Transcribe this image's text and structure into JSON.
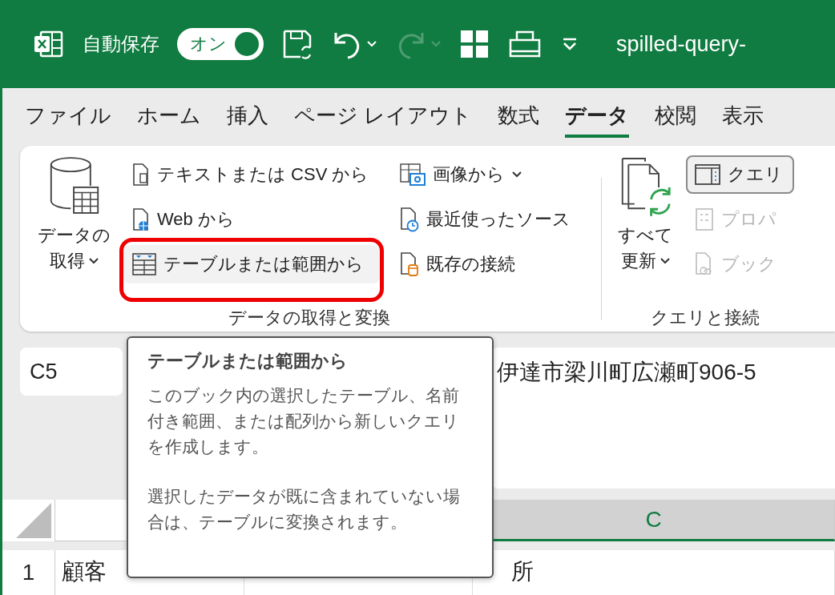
{
  "title_bar": {
    "autosave_label": "自動保存",
    "autosave": {
      "label": "オン",
      "on": true
    },
    "undo_disabled": false,
    "redo_disabled": true,
    "file_name": "spilled-query-"
  },
  "tabs": [
    {
      "label": "ファイル",
      "selected": false
    },
    {
      "label": "ホーム",
      "selected": false
    },
    {
      "label": "挿入",
      "selected": false
    },
    {
      "label": "ページ レイアウト",
      "selected": false
    },
    {
      "label": "数式",
      "selected": false
    },
    {
      "label": "データ",
      "selected": true
    },
    {
      "label": "校閲",
      "selected": false
    },
    {
      "label": "表示",
      "selected": false
    }
  ],
  "ribbon": {
    "groups": [
      {
        "label": "データの取得と変換",
        "large_button": {
          "kind": "database",
          "lines": [
            "データの",
            "取得"
          ],
          "has_caret": true
        },
        "columns": [
          [
            {
              "kind": "text-file",
              "label": "テキストまたは CSV から",
              "has_caret": false,
              "highlighted": false,
              "disabled": false,
              "checked": false
            },
            {
              "kind": "web",
              "label": "Web から",
              "has_caret": false,
              "highlighted": false,
              "disabled": false,
              "checked": false
            },
            {
              "kind": "table",
              "label": "テーブルまたは範囲から",
              "has_caret": false,
              "highlighted": true,
              "disabled": false,
              "checked": false
            }
          ],
          [
            {
              "kind": "image",
              "label": "画像から",
              "has_caret": true,
              "highlighted": false,
              "disabled": false,
              "checked": false
            },
            {
              "kind": "recent",
              "label": "最近使ったソース",
              "has_caret": false,
              "highlighted": false,
              "disabled": false,
              "checked": false
            },
            {
              "kind": "existing",
              "label": "既存の接続",
              "has_caret": false,
              "highlighted": false,
              "disabled": false,
              "checked": false
            }
          ]
        ]
      },
      {
        "label": "クエリと接続",
        "large_button": {
          "kind": "refresh",
          "lines": [
            "すべて",
            "更新"
          ],
          "has_caret": true
        },
        "columns": [
          [
            {
              "kind": "query-pane",
              "label": "クエリ",
              "has_caret": false,
              "highlighted": false,
              "disabled": false,
              "checked": true
            },
            {
              "kind": "properties",
              "label": "プロパ",
              "has_caret": false,
              "highlighted": false,
              "disabled": true,
              "checked": false
            },
            {
              "kind": "workbook-links",
              "label": "ブック",
              "has_caret": false,
              "highlighted": false,
              "disabled": true,
              "checked": false
            }
          ]
        ]
      }
    ]
  },
  "formula_bar": {
    "name_box": "C5",
    "formula": "伊達市梁川町広瀬町906-5"
  },
  "grid": {
    "columns": [
      null,
      null,
      {
        "label": "C",
        "selected": true
      }
    ],
    "rows": [
      {
        "number": "1",
        "cells": [
          "顧客",
          null,
          "所"
        ]
      }
    ]
  },
  "tooltip": {
    "title": "テーブルまたは範囲から",
    "paragraphs": [
      "このブック内の選択したテーブル、名前付き範囲、または配列から新しいクエリを作成します。",
      "選択したデータが既に含まれていない場合は、テーブルに変換されます。"
    ]
  }
}
